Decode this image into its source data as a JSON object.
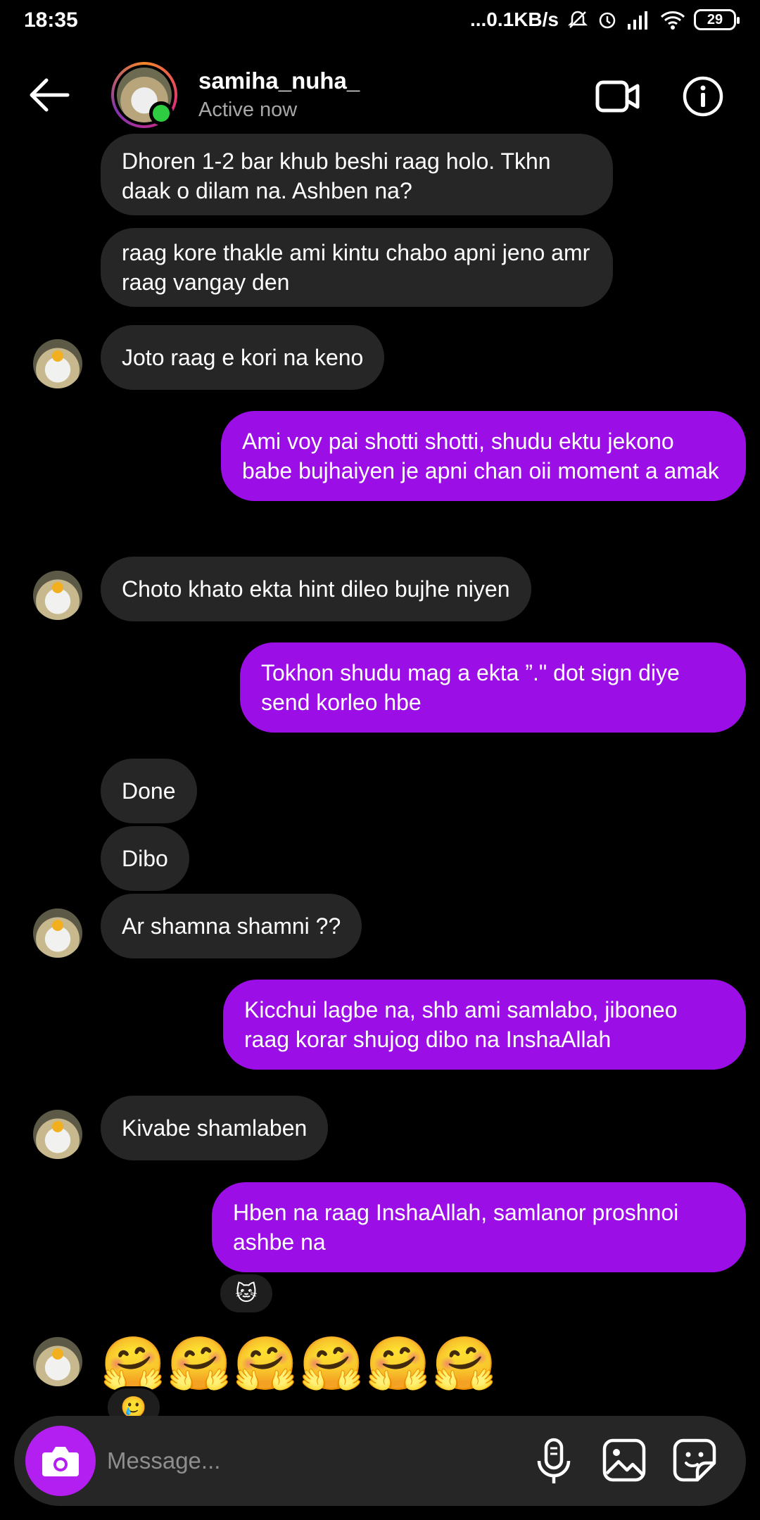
{
  "status_bar": {
    "time": "18:35",
    "network_speed": "...0.1KB/s",
    "battery": "29"
  },
  "header": {
    "username": "samiha_nuha_",
    "status": "Active now",
    "icons": [
      "back-arrow-icon",
      "video-call-icon",
      "info-icon"
    ]
  },
  "messages": [
    {
      "from": "them",
      "text": "Dhoren 1-2 bar khub beshi raag holo. Tkhn daak o dilam na. Ashben na?"
    },
    {
      "from": "them",
      "text": "raag kore thakle ami kintu chabo apni jeno amr raag vangay den"
    },
    {
      "from": "them",
      "text": "Joto raag e kori na keno"
    },
    {
      "from": "me",
      "text": "Ami voy pai shotti shotti, shudu ektu jekono babe bujhaiyen je apni chan oii moment a amak"
    },
    {
      "from": "them",
      "text": "Choto khato ekta hint dileo bujhe niyen"
    },
    {
      "from": "me",
      "text": "Tokhon shudu mag a ekta ”.\" dot sign diye send korleo hbe"
    },
    {
      "from": "them",
      "text": "Done"
    },
    {
      "from": "them",
      "text": "Dibo"
    },
    {
      "from": "them",
      "text": "Ar shamna shamni ??"
    },
    {
      "from": "me",
      "text": "Kicchui lagbe na, shb ami samlabo, jiboneo raag korar shujog dibo na InshaAllah"
    },
    {
      "from": "them",
      "text": "Kivabe shamlaben"
    },
    {
      "from": "me",
      "text": "Hben na raag InshaAllah, samlanor proshnoi ashbe na",
      "reaction": "🐱"
    },
    {
      "from": "them",
      "text": "🤗🤗🤗🤗🤗🤗",
      "reaction": "🥲"
    }
  ],
  "composer": {
    "placeholder": "Message...",
    "icons": [
      "camera-icon",
      "microphone-icon",
      "gallery-icon",
      "sticker-icon"
    ]
  },
  "colors": {
    "background": "#000000",
    "incoming_bubble": "#262626",
    "outgoing_bubble": "#9b0ee6",
    "camera_button": "#b31ff0",
    "online_dot": "#2ecc40"
  }
}
